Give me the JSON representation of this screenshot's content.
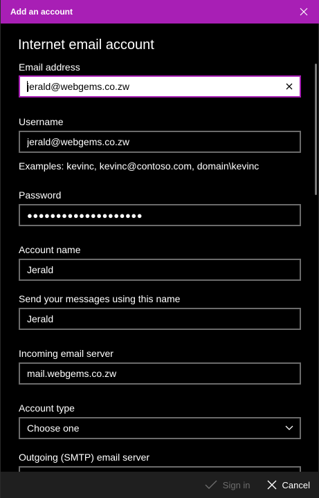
{
  "window": {
    "title": "Add an account"
  },
  "heading": "Internet email account",
  "fields": {
    "email": {
      "label": "Email address",
      "value": "jerald@webgems.co.zw"
    },
    "username": {
      "label": "Username",
      "value": "jerald@webgems.co.zw",
      "hint": "Examples: kevinc, kevinc@contoso.com, domain\\kevinc"
    },
    "password": {
      "label": "Password",
      "value": "●●●●●●●●●●●●●●●●●●●●"
    },
    "account_name": {
      "label": "Account name",
      "value": "Jerald"
    },
    "send_name": {
      "label": "Send your messages using this name",
      "value": "Jerald"
    },
    "incoming": {
      "label": "Incoming email server",
      "value": "mail.webgems.co.zw"
    },
    "account_type": {
      "label": "Account type",
      "value": "Choose one"
    },
    "outgoing": {
      "label": "Outgoing (SMTP) email server",
      "value": ""
    }
  },
  "footer": {
    "sign_in": "Sign in",
    "cancel": "Cancel"
  },
  "colors": {
    "accent": "#a81fb5",
    "footer_bg": "#1f1f1f",
    "field_border": "#6b6b6b"
  }
}
